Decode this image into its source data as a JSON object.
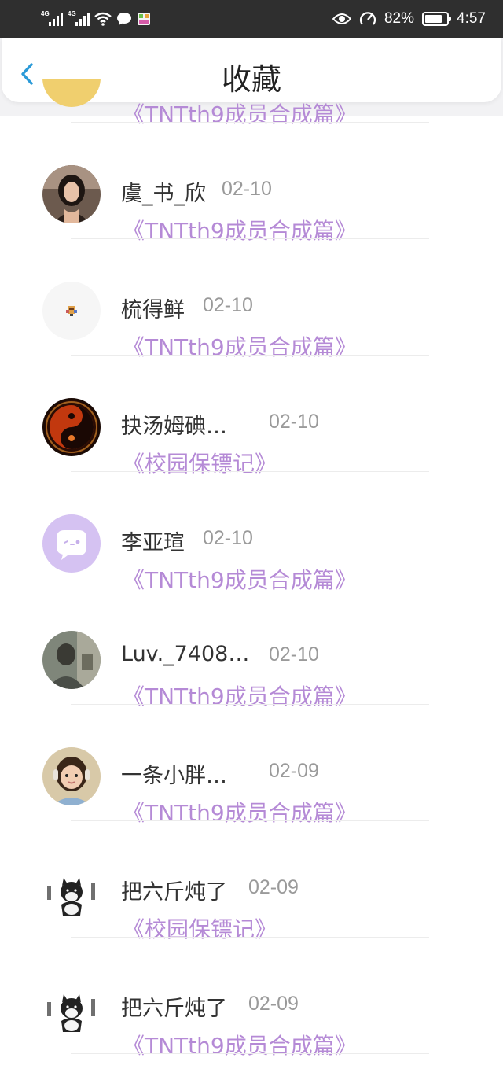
{
  "status_bar": {
    "net1": "4G",
    "net2": "4G",
    "battery_text": "82%",
    "battery_level": 0.82,
    "time": "4:57"
  },
  "header": {
    "title": "收藏"
  },
  "favorites": [
    {
      "name": "",
      "date": "",
      "work": "《TNTth9成员合成篇》"
    },
    {
      "name": "虞_书_欣",
      "date": "02-10",
      "work": "《TNTth9成员合成篇》"
    },
    {
      "name": "梳得鲜",
      "date": "02-10",
      "work": "《TNTth9成员合成篇》"
    },
    {
      "name": "抉汤姆碘…",
      "date": "02-10",
      "work": "《校园保镖记》"
    },
    {
      "name": "李亚瑄",
      "date": "02-10",
      "work": "《TNTth9成员合成篇》"
    },
    {
      "name": "Luv._7408…",
      "date": "02-10",
      "work": "《TNTth9成员合成篇》"
    },
    {
      "name": "一条小胖…",
      "date": "02-09",
      "work": "《TNTth9成员合成篇》"
    },
    {
      "name": "把六斤炖了",
      "date": "02-09",
      "work": "《校园保镖记》"
    },
    {
      "name": "把六斤炖了",
      "date": "02-09",
      "work": "《TNTth9成员合成篇》"
    }
  ],
  "colors": {
    "accent": "#2a9ad8",
    "work_link": "#b58ad6",
    "status_bar_bg": "#2f2f2f"
  },
  "icons": [
    "back-arrow-icon",
    "signal-icon",
    "wifi-icon",
    "chat-bubble-icon",
    "eye-icon",
    "speed-icon",
    "battery-icon"
  ]
}
